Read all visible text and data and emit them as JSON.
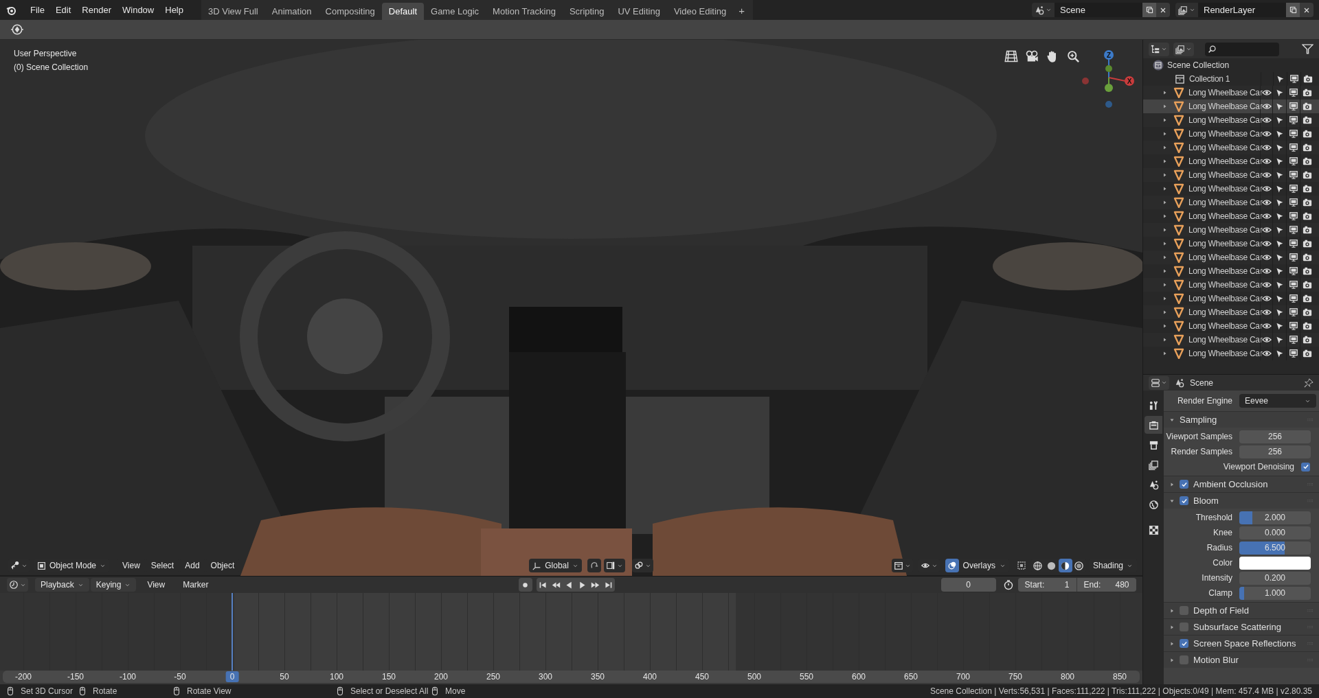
{
  "menu": [
    "File",
    "Edit",
    "Render",
    "Window",
    "Help"
  ],
  "workspaces": [
    {
      "label": "3D View Full",
      "selected": false
    },
    {
      "label": "Animation",
      "selected": false
    },
    {
      "label": "Compositing",
      "selected": false
    },
    {
      "label": "Default",
      "selected": true
    },
    {
      "label": "Game Logic",
      "selected": false
    },
    {
      "label": "Motion Tracking",
      "selected": false
    },
    {
      "label": "Scripting",
      "selected": false
    },
    {
      "label": "UV Editing",
      "selected": false
    },
    {
      "label": "Video Editing",
      "selected": false
    }
  ],
  "add_workspace": "+",
  "scene": "Scene",
  "view_layer": "RenderLayer",
  "viewport": {
    "kind": "picture",
    "view_name": "User Perspective",
    "collection": "(0) Scene Collection",
    "axes": {
      "z": "Z",
      "x": "X"
    },
    "header": {
      "mode": "Object Mode",
      "menus": [
        "View",
        "Select",
        "Add",
        "Object"
      ],
      "orientation": "Global",
      "overlays": {
        "label": "Overlays",
        "on": true
      },
      "shading_modes": [
        {
          "selected": false
        },
        {
          "selected": false
        },
        {
          "selected": true
        },
        {
          "selected": false
        }
      ],
      "shading": "Shading"
    }
  },
  "outliner": {
    "root": "Scene Collection",
    "children": [
      {
        "kind": "collection",
        "label": "Collection 1",
        "selected": false
      },
      {
        "kind": "object",
        "label": "Long Wheelbase Car",
        "selected": false
      },
      {
        "kind": "object",
        "label": "Long Wheelbase Car",
        "selected": true
      },
      {
        "kind": "object",
        "label": "Long Wheelbase Car",
        "selected": false
      },
      {
        "kind": "object",
        "label": "Long Wheelbase Car",
        "selected": false
      },
      {
        "kind": "object",
        "label": "Long Wheelbase Car",
        "selected": false
      },
      {
        "kind": "object",
        "label": "Long Wheelbase Car",
        "selected": false
      },
      {
        "kind": "object",
        "label": "Long Wheelbase Car",
        "selected": false
      },
      {
        "kind": "object",
        "label": "Long Wheelbase Car",
        "selected": false
      },
      {
        "kind": "object",
        "label": "Long Wheelbase Car",
        "selected": false
      },
      {
        "kind": "object",
        "label": "Long Wheelbase Car",
        "selected": false
      },
      {
        "kind": "object",
        "label": "Long Wheelbase Car",
        "selected": false
      },
      {
        "kind": "object",
        "label": "Long Wheelbase Car",
        "selected": false
      },
      {
        "kind": "object",
        "label": "Long Wheelbase Car",
        "selected": false
      },
      {
        "kind": "object",
        "label": "Long Wheelbase Car",
        "selected": false
      },
      {
        "kind": "object",
        "label": "Long Wheelbase Car",
        "selected": false
      },
      {
        "kind": "object",
        "label": "Long Wheelbase Car",
        "selected": false
      },
      {
        "kind": "object",
        "label": "Long Wheelbase Car",
        "selected": false
      },
      {
        "kind": "object",
        "label": "Long Wheelbase Car",
        "selected": false
      },
      {
        "kind": "object",
        "label": "Long Wheelbase Car",
        "selected": false
      },
      {
        "kind": "object",
        "label": "Long Wheelbase Car",
        "selected": false
      }
    ]
  },
  "properties": {
    "context": "Scene",
    "tabs": [
      {
        "selected": false
      },
      {
        "selected": true
      },
      {
        "selected": false
      },
      {
        "selected": false
      },
      {
        "selected": false
      },
      {
        "selected": false
      },
      {
        "selected": false
      }
    ],
    "render_engine": {
      "label": "Render Engine",
      "value": "Eevee"
    },
    "panels": [
      {
        "title": "Sampling",
        "kind": "plain",
        "expanded": true,
        "fields": [
          {
            "kind": "number",
            "label": "Viewport Samples",
            "value": "256"
          },
          {
            "kind": "number",
            "label": "Render Samples",
            "value": "256"
          },
          {
            "kind": "checkbox",
            "label": "Viewport Denoising",
            "checked": true
          }
        ]
      },
      {
        "title": "Ambient Occlusion",
        "kind": "toggle",
        "checked": true,
        "expanded": false
      },
      {
        "title": "Bloom",
        "kind": "toggle",
        "checked": true,
        "expanded": true,
        "fields": [
          {
            "kind": "slider",
            "label": "Threshold",
            "value": "2.000",
            "level": 0.18
          },
          {
            "kind": "number",
            "label": "Knee",
            "value": "0.000"
          },
          {
            "kind": "slider",
            "label": "Radius",
            "value": "6.500",
            "level": 0.63
          },
          {
            "kind": "color",
            "label": "Color",
            "color": "#ffffff"
          },
          {
            "kind": "number",
            "label": "Intensity",
            "value": "0.200"
          },
          {
            "kind": "slider",
            "label": "Clamp",
            "value": "1.000",
            "level": 0.07
          }
        ]
      },
      {
        "title": "Depth of Field",
        "kind": "toggle",
        "checked": false,
        "expanded": false
      },
      {
        "title": "Subsurface Scattering",
        "kind": "toggle",
        "checked": false,
        "expanded": false
      },
      {
        "title": "Screen Space Reflections",
        "kind": "toggle",
        "checked": true,
        "expanded": false
      },
      {
        "title": "Motion Blur",
        "kind": "toggle",
        "checked": false,
        "expanded": false
      }
    ]
  },
  "timeline": {
    "menus": [
      {
        "kind": "dropdown",
        "label": "Playback"
      },
      {
        "kind": "dropdown",
        "label": "Keying"
      },
      {
        "kind": "menu",
        "label": "View"
      },
      {
        "kind": "menu",
        "label": "Marker"
      }
    ],
    "current_frame": "0",
    "start": {
      "label": "Start:",
      "value": "1"
    },
    "end": {
      "label": "End:",
      "value": "480"
    },
    "ruler": [
      {
        "label": "-200",
        "selected": false
      },
      {
        "label": "-150",
        "selected": false
      },
      {
        "label": "-100",
        "selected": false
      },
      {
        "label": "-50",
        "selected": false
      },
      {
        "label": "0",
        "selected": true
      },
      {
        "label": "50",
        "selected": false
      },
      {
        "label": "100",
        "selected": false
      },
      {
        "label": "150",
        "selected": false
      },
      {
        "label": "200",
        "selected": false
      },
      {
        "label": "250",
        "selected": false
      },
      {
        "label": "300",
        "selected": false
      },
      {
        "label": "350",
        "selected": false
      },
      {
        "label": "400",
        "selected": false
      },
      {
        "label": "450",
        "selected": false
      },
      {
        "label": "500",
        "selected": false
      },
      {
        "label": "550",
        "selected": false
      },
      {
        "label": "600",
        "selected": false
      },
      {
        "label": "650",
        "selected": false
      },
      {
        "label": "700",
        "selected": false
      },
      {
        "label": "750",
        "selected": false
      },
      {
        "label": "800",
        "selected": false
      },
      {
        "label": "850",
        "selected": false
      }
    ]
  },
  "status_bar": {
    "hints": [
      "Set 3D Cursor",
      "Rotate",
      "Rotate View",
      "Select or Deselect All",
      "Move"
    ],
    "stats": "Scene Collection | Verts:56,531 | Faces:111,222 | Tris:111,222 | Objects:0/49 | Mem: 457.4 MB | v2.80.35"
  }
}
